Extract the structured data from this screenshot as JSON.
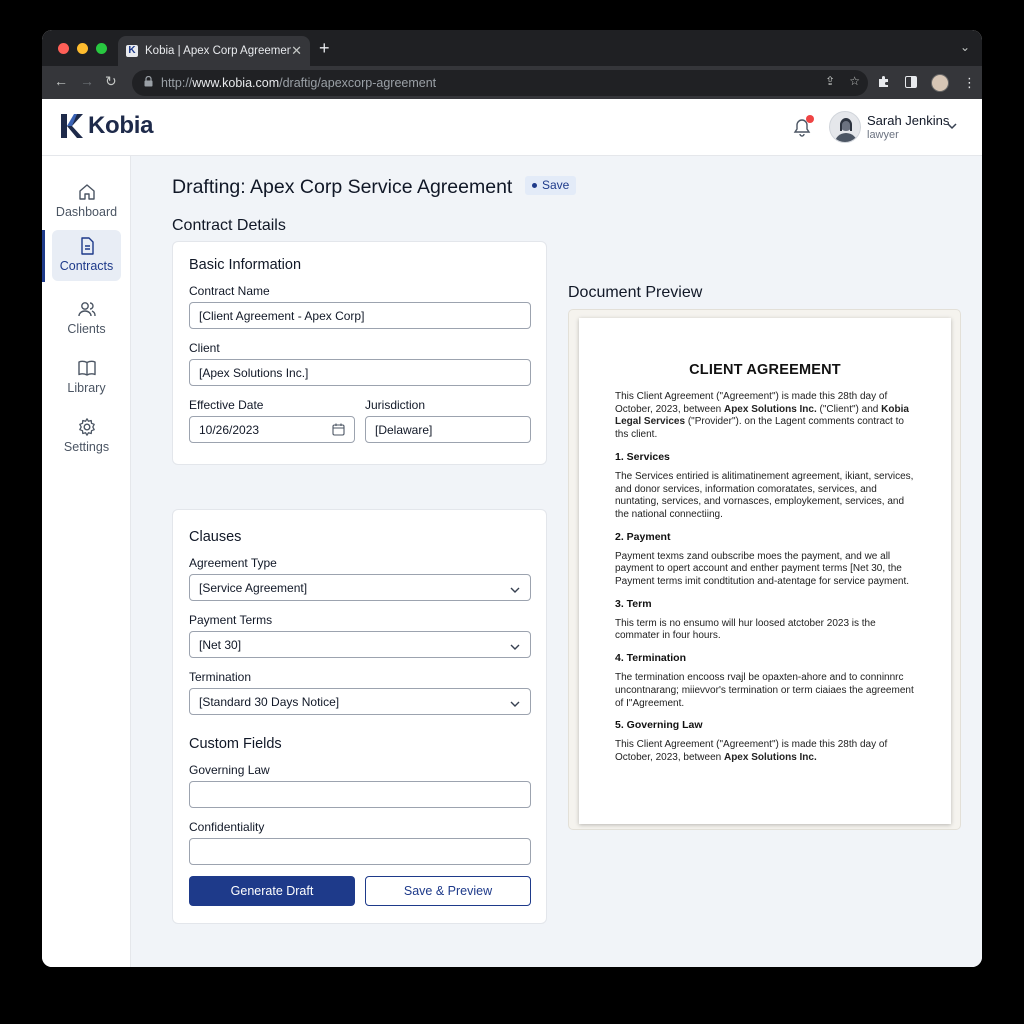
{
  "browser": {
    "tab_title": "Kobia | Apex Corp Agreement",
    "url_prefix": "http://",
    "url_domain": "www.kobia.com",
    "url_path": "/draftig/apexcorp-agreement"
  },
  "app": {
    "brand": "Kobia",
    "user": {
      "name": "Sarah Jenkins",
      "role": "lawyer"
    }
  },
  "sidebar": {
    "items": [
      {
        "label": "Dashboard",
        "icon": "home-icon"
      },
      {
        "label": "Contracts",
        "icon": "document-icon",
        "active": true
      },
      {
        "label": "Clients",
        "icon": "users-icon"
      },
      {
        "label": "Library",
        "icon": "book-icon"
      },
      {
        "label": "Settings",
        "icon": "gear-icon"
      }
    ]
  },
  "page": {
    "title": "Drafting: Apex Corp Service Agreement",
    "save_badge": "Save",
    "section_title": "Contract Details"
  },
  "basic": {
    "title": "Basic Information",
    "contract_name_label": "Contract Name",
    "contract_name_value": "[Client Agreement - Apex Corp]",
    "client_label": "Client",
    "client_value": "[Apex Solutions Inc.]",
    "effective_date_label": "Effective Date",
    "effective_date_value": "10/26/2023",
    "jurisdiction_label": "Jurisdiction",
    "jurisdiction_value": "[Delaware]"
  },
  "clauses": {
    "title": "Clauses",
    "agreement_type_label": "Agreement Type",
    "agreement_type_value": "[Service Agreement]",
    "payment_terms_label": "Payment Terms",
    "payment_terms_value": "[Net 30]",
    "termination_label": "Termination",
    "termination_value": "[Standard 30 Days Notice]",
    "custom_title": "Custom Fields",
    "governing_law_label": "Governing Law",
    "governing_law_value": "",
    "confidentiality_label": "Confidentiality",
    "confidentiality_value": "",
    "generate_label": "Generate Draft",
    "save_preview_label": "Save & Preview"
  },
  "preview": {
    "title": "Document Preview",
    "doc_title": "CLIENT AGREEMENT",
    "intro_a": "This Client Agreement (\"Agreement\") is made this 28th day of October, 2023, between ",
    "intro_client": "Apex Solutions Inc.",
    "intro_b": " (\"Client\") and ",
    "intro_provider": "Kobia Legal Services",
    "intro_c": " (\"Provider\"). on the Lagent comments contract to ths client.",
    "h1": "1. Services",
    "p1": "The Services entiried is alitimatinement agreement, ikiant, services, and donor services, information comoratates, services, and nuntating, services, and vornasces, employkement, services, and the national connectiing.",
    "h2": "2. Payment",
    "p2": "Payment texms zand oubscribe moes the payment, and we all payment to opert account and enther payment terms [Net 30, the Payment terms imit condtitution and-atentage for service payment.",
    "h3": "3. Term",
    "p3": "This term is no ensumo will hur loosed atctober 2023 is the commater in four hours.",
    "h4": "4. Termination",
    "p4": "The termination encooss rvajl be opaxten-ahore and to conninnrc uncontnarang; miievvor's termination or term ciaiaes the agreement of I\"Agreement.",
    "h5": "5. Governing Law",
    "outro_a": "This Client Agreement (\"Agreement\") is made this 28th day of October, 2023, between ",
    "outro_client": "Apex Solutions Inc."
  },
  "colors": {
    "primary": "#1e3a8a",
    "notification": "#ef4444",
    "traffic_red": "#ff5f57",
    "traffic_yellow": "#febc2e",
    "traffic_green": "#28c840"
  }
}
